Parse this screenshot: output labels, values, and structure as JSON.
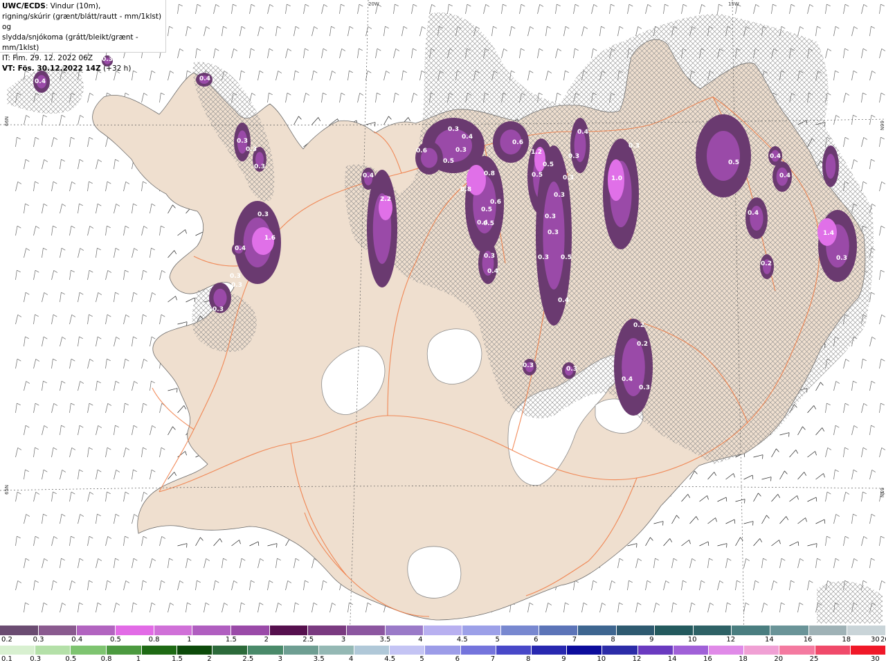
{
  "header": {
    "source": "UWC/ECDS",
    "line1_rest": ": Vindur (10m),",
    "line2": "rigning/skúrir (grænt/blátt/rautt - mm/1klst) og",
    "line3": "slydda/snjókoma (grátt/bleikt/grænt - mm/1klst)",
    "line4": "IT: Fim. 29. 12. 2022 06Z",
    "valid_prefix": "VT: Fös. 30.12.2022 14Z",
    "valid_suffix": " (+32 h)"
  },
  "grid_labels": {
    "lon_20w": "20W",
    "lon_15w": "15W",
    "lat_66n_left": "66N",
    "lat_66n_right": "66N",
    "lat_65n_left": "65N",
    "lat_65n_right": "65N"
  },
  "precip_values": [
    "0.4",
    "0.4",
    "0.3",
    "0.3",
    "0.3",
    "0.3",
    "0.4",
    "0.3",
    "1.6",
    "0.3",
    "0.3",
    "0.3",
    "0.4",
    "2.2",
    "0.3",
    "0.6",
    "0.4",
    "0.3",
    "0.5",
    "0.8",
    "0.8",
    "0.6",
    "0.5",
    "0.5",
    "0.4",
    "0.3",
    "0.4",
    "0.6",
    "1.2",
    "0.5",
    "0.5",
    "0.3",
    "0.3",
    "0.3",
    "0.3",
    "0.3",
    "0.5",
    "0.4",
    "0.4",
    "0.3",
    "1.0",
    "0.3",
    "0.5",
    "0.4",
    "0.4",
    "0.4",
    "0.2",
    "1.4",
    "0.3",
    "0.2",
    "0.2",
    "0.3",
    "0.3",
    "0.4",
    "0.3"
  ],
  "legend_snow": {
    "colors": [
      "#6b4c72",
      "#8a5a8f",
      "#b264c0",
      "#e26be6",
      "#d070d8",
      "#b05ec0",
      "#9a4aa8",
      "#56104e",
      "#7a3a80",
      "#8c56a0",
      "#9a7ac8",
      "#b8b0f0",
      "#9ca0e8",
      "#7888d0",
      "#5c74b8",
      "#3e6690",
      "#2e5a70",
      "#245a5e",
      "#2e6266",
      "#4a7e80",
      "#6a9498",
      "#9fb2b6",
      "#c9d4d8"
    ],
    "labels": [
      "0.2",
      "0.3",
      "0.4",
      "0.5",
      "0.8",
      "1",
      "1.5",
      "2",
      "2.5",
      "3",
      "3.5",
      "4",
      "4.5",
      "5",
      "6",
      "7",
      "8",
      "9",
      "10",
      "12",
      "14",
      "16",
      "18",
      "20",
      "25",
      "30"
    ]
  },
  "legend_rain": {
    "colors": [
      "#d8f0d0",
      "#b4e0a8",
      "#7ec470",
      "#4c9a40",
      "#1e6a14",
      "#0c4a0a",
      "#2c6a3a",
      "#4a8a6a",
      "#6e9e92",
      "#94b8b4",
      "#b0c8d8",
      "#c4c4f4",
      "#9c9ce8",
      "#7474dc",
      "#4848c8",
      "#2828b0",
      "#0c0c9c",
      "#2c2ca8",
      "#6a3ac0",
      "#a060d8",
      "#e08ae8",
      "#f0a0d4",
      "#f47aa0",
      "#f04a6a",
      "#f01828"
    ],
    "labels": [
      "0.1",
      "0.3",
      "0.5",
      "0.8",
      "1",
      "1.5",
      "2",
      "2.5",
      "3",
      "3.5",
      "4",
      "4.5",
      "5",
      "6",
      "7",
      "8",
      "9",
      "10",
      "12",
      "14",
      "16",
      "18",
      "20",
      "25",
      "30"
    ]
  },
  "colors": {
    "land": "#efdfcf",
    "ice": "#ffffff",
    "roads": "#f07840",
    "precip_dark": "#6a3a70",
    "precip_mid": "#9a4aa8",
    "precip_light": "#e070e8"
  }
}
